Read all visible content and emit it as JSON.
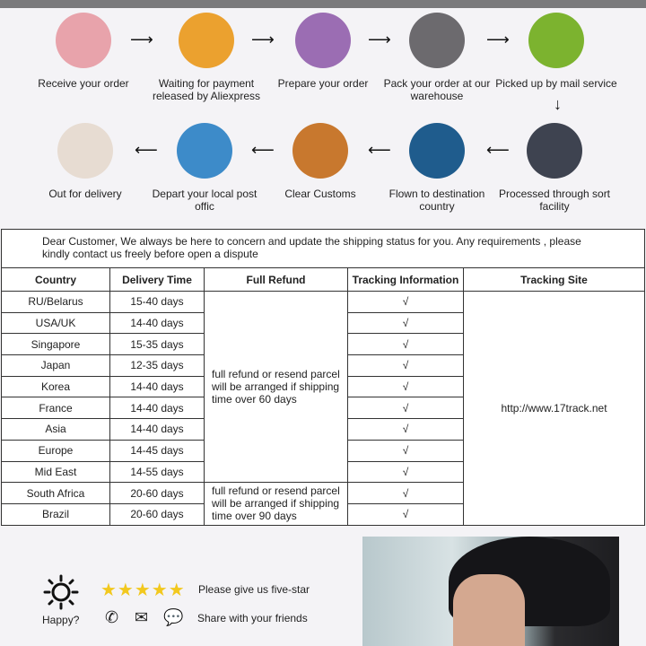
{
  "steps_row1": [
    {
      "label": "Receive your order",
      "icon": "person-at-laptop-icon",
      "color": "#e8a3ab"
    },
    {
      "label": "Waiting for payment released by Aliexpress",
      "icon": "money-bag-icon",
      "color": "#eba12f"
    },
    {
      "label": "Prepare your order",
      "icon": "printer-icon",
      "color": "#9b6db3"
    },
    {
      "label": "Pack your order at our warehouse",
      "icon": "package-worker-icon",
      "color": "#6c6a6e"
    },
    {
      "label": "Picked up by mail service",
      "icon": "truck-icon",
      "color": "#7cb32f"
    }
  ],
  "steps_row2": [
    {
      "label": "Out for delivery",
      "icon": "parcel-icon",
      "color": "#e7dcd2"
    },
    {
      "label": "Depart your local post offic",
      "icon": "van-icon",
      "color": "#3d8bc9"
    },
    {
      "label": "Clear  Customs",
      "icon": "customs-officer-icon",
      "color": "#c8782e"
    },
    {
      "label": "Flown to destination country",
      "icon": "airplane-icon",
      "color": "#1f5c8d"
    },
    {
      "label": "Processed through sort facility",
      "icon": "globe-sorting-icon",
      "color": "#3e4350"
    }
  ],
  "notice": "Dear Customer, We always be here to concern and update the shipping status for you.  Any requirements , please kindly contact us freely before open a dispute",
  "table": {
    "headers": [
      "Country",
      "Delivery Time",
      "Full Refund",
      "Tracking Information",
      "Tracking Site"
    ],
    "rows": [
      [
        "RU/Belarus",
        "15-40 days"
      ],
      [
        "USA/UK",
        "14-40 days"
      ],
      [
        "Singapore",
        "15-35 days"
      ],
      [
        "Japan",
        "12-35 days"
      ],
      [
        "Korea",
        "14-40 days"
      ],
      [
        "France",
        "14-40 days"
      ],
      [
        "Asia",
        "14-40 days"
      ],
      [
        "Europe",
        "14-45 days"
      ],
      [
        "Mid East",
        "14-55 days"
      ],
      [
        "South Africa",
        "20-60 days"
      ],
      [
        "Brazil",
        "20-60 days"
      ]
    ],
    "refund_60": "full refund or resend parcel will be arranged if shipping time over 60 days",
    "refund_90": "full refund or resend parcel will be arranged if shipping time over 90 days",
    "check": "√",
    "site": "http://www.17track.net"
  },
  "feedback": {
    "happy": "Happy?",
    "five_star": "Please give us five-star",
    "share": "Share with your friends"
  }
}
